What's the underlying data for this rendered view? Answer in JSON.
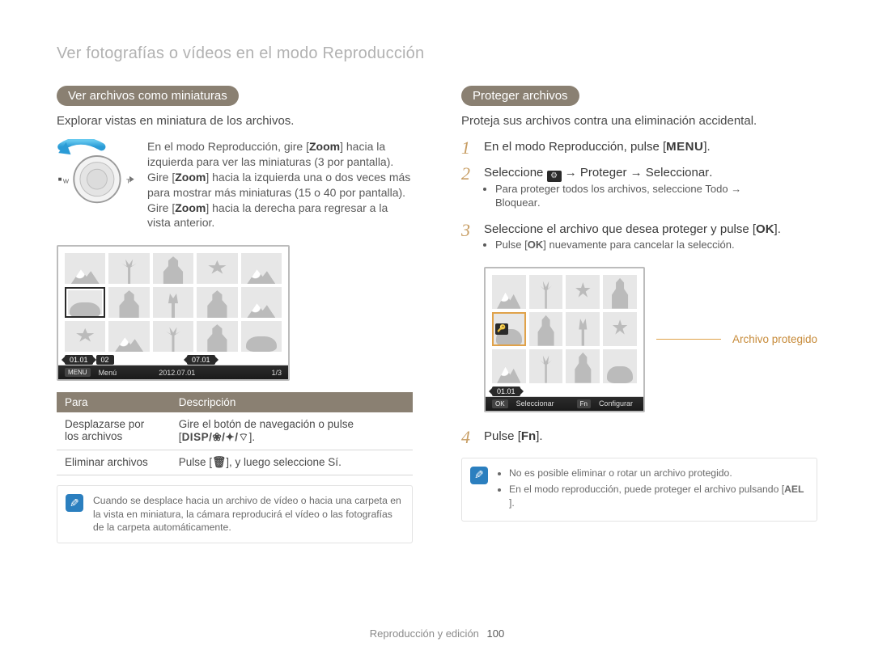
{
  "header": {
    "title": "Ver fotografías o vídeos en el modo Reproducción"
  },
  "left": {
    "pill": "Ver archivos como miniaturas",
    "subtitle": "Explorar vistas en miniatura de los archivos.",
    "dial_text": {
      "p1a": "En el modo Reproducción, gire [",
      "zoom": "Zoom",
      "p1b": "] hacia la izquierda para ver las miniaturas (3 por pantalla). Gire [",
      "p1c": "] hacia la izquierda una o dos veces más para mostrar más miniaturas (15 o 40 por pantalla). Gire [",
      "p1d": "] hacia la derecha para regresar a la vista anterior."
    },
    "screenA": {
      "date1": "01.01",
      "date2": "02",
      "date3": "07.01",
      "footer_menu_tag": "MENU",
      "footer_menu": "Menú",
      "footer_date": "2012.07.01",
      "footer_page": "1/3"
    },
    "table": {
      "h1": "Para",
      "h2": "Descripción",
      "r1c1a": "Desplazarse por",
      "r1c1b": "los archivos",
      "r1c2a": "Gire el botón de navegación o pulse",
      "r1c2b": "[",
      "r1c2_disp": "DISP/❀/✦/⌔",
      "r1c2c": "].",
      "r2c1": "Eliminar archivos",
      "r2c2a": "Pulse [",
      "r2c2_trash": "🗑",
      "r2c2b": "], y luego seleccione ",
      "r2c2_si": "Sí",
      "r2c2c": "."
    },
    "note": "Cuando se desplace hacia un archivo de vídeo o hacia una carpeta en la vista en miniatura, la cámara reproducirá el vídeo o las fotografías de la carpeta automáticamente."
  },
  "right": {
    "pill": "Proteger archivos",
    "subtitle": "Proteja sus archivos contra una eliminación accidental.",
    "step1": {
      "a": "En el modo Reproducción, pulse [",
      "menu": "MENU",
      "b": "]."
    },
    "step2": {
      "a": "Seleccione ",
      "b": " → ",
      "proteger": "Proteger",
      "c": " → ",
      "seleccionar": "Seleccionar",
      "d": ".",
      "bullet_a": "Para proteger todos los archivos, seleccione ",
      "todo": "Todo",
      "bullet_b": " → ",
      "bloquear": "Bloquear",
      "bullet_c": "."
    },
    "step3": {
      "a": "Seleccione el archivo que desea proteger y pulse [",
      "ok": "OK",
      "b": "].",
      "bullet_a": "Pulse [",
      "bullet_b": "] nuevamente para cancelar la selección."
    },
    "screenB": {
      "date1": "01.01",
      "footer_ok_tag": "OK",
      "footer_ok": "Seleccionar",
      "footer_fn_tag": "Fn",
      "footer_fn": "Configurar"
    },
    "callout": "Archivo protegido",
    "step4": {
      "a": "Pulse [",
      "fn": "Fn",
      "b": "]."
    },
    "note": {
      "li1": "No es posible eliminar o rotar un archivo protegido.",
      "li2a": "En el modo reproducción, puede proteger el archivo pulsando [",
      "ael": "AEL",
      "li2b": "]."
    }
  },
  "footer": {
    "section": "Reproducción y edición",
    "page": "100"
  }
}
